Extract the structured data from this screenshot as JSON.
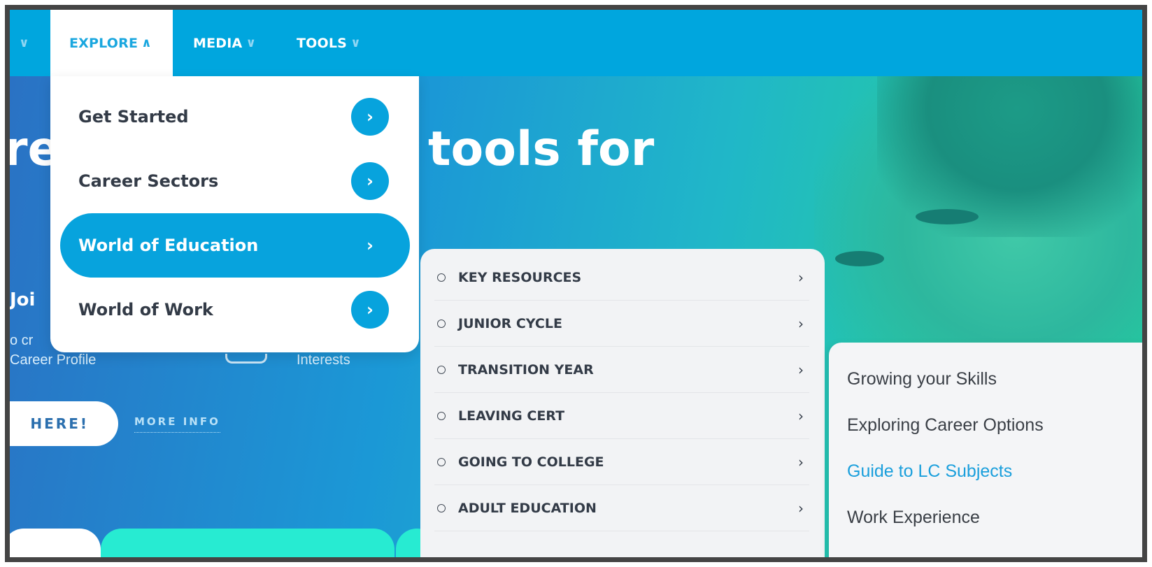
{
  "nav": {
    "items": [
      {
        "label": "",
        "chevron": "chevron-down"
      },
      {
        "label": "EXPLORE",
        "chevron": "chevron-up",
        "active": true
      },
      {
        "label": "MEDIA",
        "chevron": "chevron-down"
      },
      {
        "label": "TOOLS",
        "chevron": "chevron-down"
      }
    ]
  },
  "hero": {
    "title_left": "re",
    "title_right": "tools for",
    "join": "Joi",
    "line1": "o cr",
    "line2": "Career Profile",
    "interests": "Interests",
    "cta_label": "HERE!",
    "more_info": "MORE INFO"
  },
  "explore_menu": {
    "items": [
      {
        "label": "Get Started"
      },
      {
        "label": "Career Sectors"
      },
      {
        "label": "World of Education",
        "active": true
      },
      {
        "label": "World of Work"
      }
    ],
    "arrow": "›"
  },
  "education_menu": {
    "items": [
      {
        "label": "KEY RESOURCES"
      },
      {
        "label": "JUNIOR CYCLE"
      },
      {
        "label": "TRANSITION YEAR"
      },
      {
        "label": "LEAVING CERT"
      },
      {
        "label": "GOING TO COLLEGE"
      },
      {
        "label": "ADULT EDUCATION"
      }
    ],
    "arrow": "›"
  },
  "lc_menu": {
    "items": [
      {
        "label": "Growing your Skills"
      },
      {
        "label": "Exploring Career Options"
      },
      {
        "label": "Guide to LC Subjects",
        "highlight": true
      },
      {
        "label": "Work Experience"
      }
    ]
  },
  "colors": {
    "nav_bg": "#00a6de",
    "accent": "#07a3dd",
    "text_dark": "#333b47",
    "link_highlight": "#1a9fdc"
  }
}
